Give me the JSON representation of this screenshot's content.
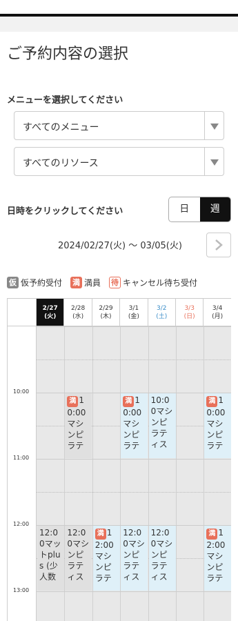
{
  "page": {
    "title": "ご予約内容の選択",
    "menu_label": "メニューを選択してください",
    "menu_select": "すべてのメニュー",
    "resource_select": "すべてのリソース",
    "date_label": "日時をクリックしてください",
    "view_day": "日",
    "view_week": "週",
    "range": "2024/02/27(火) 〜 03/05(火)"
  },
  "legend": [
    {
      "badge": "仮",
      "text": "仮予約受付"
    },
    {
      "badge": "満",
      "text": "満員"
    },
    {
      "badge": "待",
      "text": "キャンセル待ち受付"
    }
  ],
  "days": [
    {
      "date": "2/27",
      "dow": "(火)",
      "kind": "selected"
    },
    {
      "date": "2/28",
      "dow": "(水)",
      "kind": "weekday"
    },
    {
      "date": "2/29",
      "dow": "(木)",
      "kind": "weekday"
    },
    {
      "date": "3/1",
      "dow": "(金)",
      "kind": "weekday"
    },
    {
      "date": "3/2",
      "dow": "(土)",
      "kind": "sat"
    },
    {
      "date": "3/3",
      "dow": "(日)",
      "kind": "sun"
    },
    {
      "date": "3/4",
      "dow": "(月)",
      "kind": "weekday"
    }
  ],
  "times": [
    "10:00",
    "11:00",
    "12:00",
    "13:00"
  ],
  "slots": [
    {
      "day": 1,
      "hour": 10,
      "status": "full",
      "badge": "満",
      "text": "10:00マシンピラテ"
    },
    {
      "day": 3,
      "hour": 10,
      "status": "avail",
      "badge": "満",
      "text": "10:00マシンピラテ"
    },
    {
      "day": 4,
      "hour": 10,
      "status": "avail",
      "badge": "",
      "text": "10:00マシンピラティス"
    },
    {
      "day": 6,
      "hour": 10,
      "status": "avail",
      "badge": "満",
      "text": "10:00マシンピラテ"
    },
    {
      "day": 0,
      "hour": 12,
      "status": "full",
      "badge": "",
      "text": "12:00マットplus (少人数"
    },
    {
      "day": 1,
      "hour": 12,
      "status": "full",
      "badge": "",
      "text": "12:00マシンピラティス"
    },
    {
      "day": 2,
      "hour": 12,
      "status": "avail",
      "badge": "満",
      "text": "12:00マシンピラテ"
    },
    {
      "day": 3,
      "hour": 12,
      "status": "avail",
      "badge": "",
      "text": "12:00マシンピラティス"
    },
    {
      "day": 4,
      "hour": 12,
      "status": "avail",
      "badge": "",
      "text": "12:00マシンピラティス"
    },
    {
      "day": 6,
      "hour": 12,
      "status": "avail",
      "badge": "満",
      "text": "12:00マシンピラテ"
    }
  ],
  "colors": {
    "accent": "#111111",
    "full_badge": "#e8705a",
    "avail_bg": "#dff0f8",
    "sat": "#3a8dc8",
    "sun": "#e8705a"
  }
}
